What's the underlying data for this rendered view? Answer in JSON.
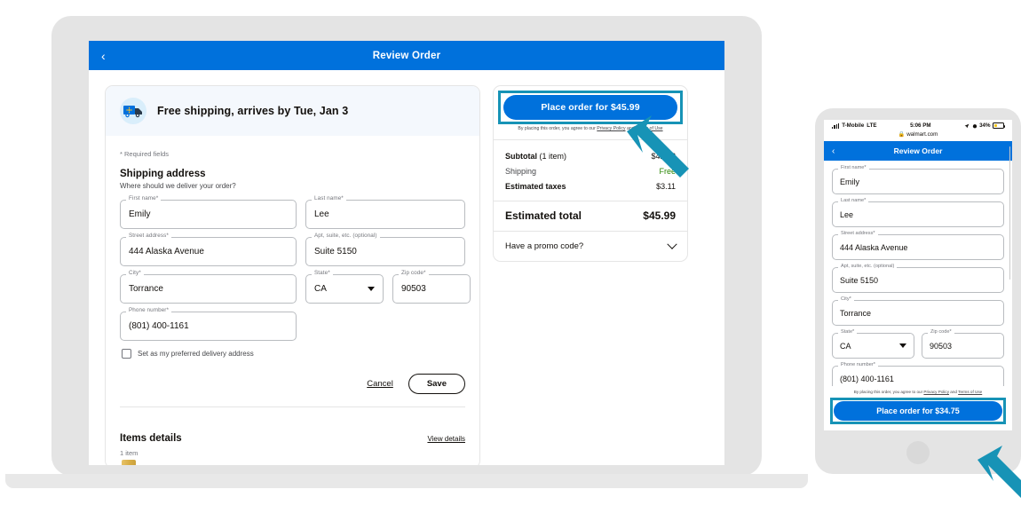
{
  "desktop": {
    "header": {
      "title": "Review Order",
      "back_icon": "chevron-left-icon"
    },
    "shipping_banner": {
      "icon": "delivery-truck-icon",
      "text": "Free shipping, arrives by Tue, Jan 3"
    },
    "required_note": "* Required fields",
    "section_title": "Shipping address",
    "section_subtitle": "Where should we deliver your order?",
    "fields": {
      "first_name": {
        "label": "First name*",
        "value": "Emily"
      },
      "last_name": {
        "label": "Last name*",
        "value": "Lee"
      },
      "street": {
        "label": "Street address*",
        "value": "444 Alaska Avenue"
      },
      "apt": {
        "label": "Apt, suite, etc. (optional)",
        "value": "Suite 5150"
      },
      "city": {
        "label": "City*",
        "value": "Torrance"
      },
      "state": {
        "label": "State*",
        "value": "CA"
      },
      "zip": {
        "label": "Zip code*",
        "value": "90503"
      },
      "phone": {
        "label": "Phone number*",
        "value": "(801) 400-1161"
      }
    },
    "checkbox_label": "Set as my preferred delivery address",
    "cancel_label": "Cancel",
    "save_label": "Save",
    "items": {
      "title": "Items details",
      "view_details": "View details",
      "count": "1 item"
    },
    "summary": {
      "place_order_label": "Place order for $45.99",
      "legal_prefix": "By placing this order, you agree to our ",
      "legal_privacy": "Privacy Policy",
      "legal_mid": " and ",
      "legal_terms": "Terms of Use",
      "subtotal_label": "Subtotal",
      "subtotal_qty": " (1 item)",
      "subtotal_value": "$42.88",
      "shipping_label": "Shipping",
      "shipping_value": "Free",
      "taxes_label": "Estimated taxes",
      "taxes_value": "$3.11",
      "total_label": "Estimated total",
      "total_value": "$45.99",
      "promo_label": "Have a promo code?",
      "promo_icon": "chevron-down-icon"
    }
  },
  "mobile": {
    "status": {
      "signal_icon": "signal-bars-icon",
      "carrier": "T-Mobile",
      "network": "LTE",
      "time": "5:06 PM",
      "location_icon": "location-arrow-icon",
      "alarm_icon": "alarm-clock-icon",
      "battery_percent": "34%",
      "battery_icon": "battery-low-power-icon"
    },
    "url": "walmart.com",
    "lock_icon": "lock-icon",
    "header": {
      "title": "Review Order",
      "back_icon": "chevron-left-icon"
    },
    "fields": {
      "first_name": {
        "label": "First name*",
        "value": "Emily"
      },
      "last_name": {
        "label": "Last name*",
        "value": "Lee"
      },
      "street": {
        "label": "Street address*",
        "value": "444 Alaska Avenue"
      },
      "apt": {
        "label": "Apt, suite, etc. (optional)",
        "value": "Suite 5150"
      },
      "city": {
        "label": "City*",
        "value": "Torrance"
      },
      "state": {
        "label": "State*",
        "value": "CA"
      },
      "zip": {
        "label": "Zip code*",
        "value": "90503"
      },
      "phone": {
        "label": "Phone number*",
        "value": "(801) 400-1161"
      }
    },
    "legal_prefix": "By placing this order, you agree to our ",
    "legal_privacy": "Privacy Policy",
    "legal_mid": " and ",
    "legal_terms": "Terms of Use",
    "place_order_label": "Place order for $34.75"
  },
  "colors": {
    "brand_blue": "#0071dc",
    "highlight_teal": "#1793b6",
    "free_green": "#2a8703",
    "device_gray": "#e4e4e4"
  }
}
